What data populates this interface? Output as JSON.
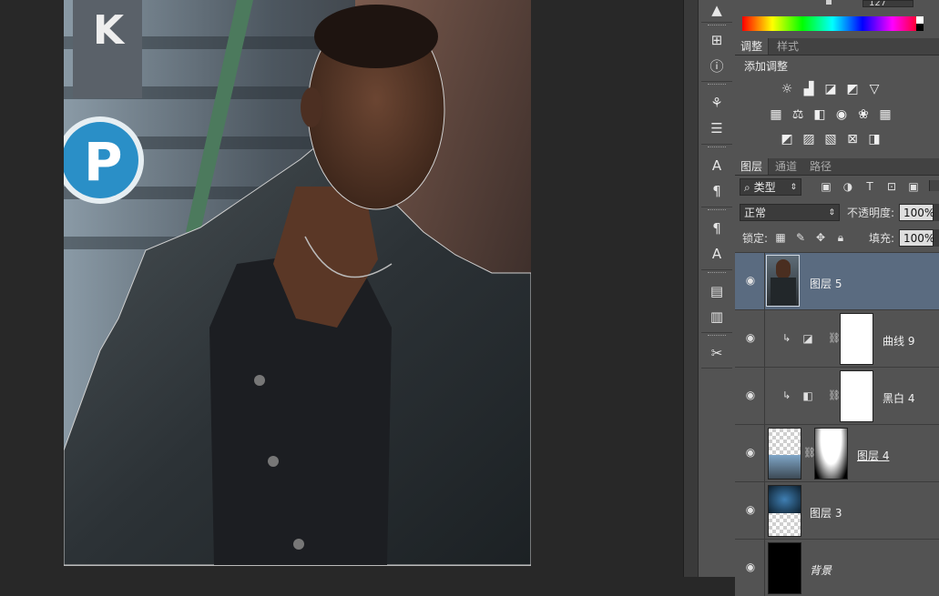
{
  "color_panel": {
    "value_field": "127"
  },
  "adjustments": {
    "tabs": [
      "调整",
      "样式"
    ],
    "title": "添加调整",
    "row1_icons": [
      "brightness-contrast-icon",
      "levels-icon",
      "curves-icon",
      "exposure-icon",
      "gradient-triangle-icon"
    ],
    "row2_icons": [
      "vibrance-icon",
      "color-balance-icon",
      "black-white-icon",
      "photo-filter-icon",
      "channel-mixer-icon",
      "color-lookup-icon"
    ],
    "row3_icons": [
      "invert-icon",
      "posterize-icon",
      "threshold-icon",
      "selective-color-icon",
      "gradient-map-icon"
    ]
  },
  "layers_panel": {
    "tabs": [
      "图层",
      "通道",
      "路径"
    ],
    "filter_kind": "类型",
    "blend_mode": "正常",
    "opacity_label": "不透明度:",
    "opacity_value": "100%",
    "lock_label": "锁定:",
    "fill_label": "填充:",
    "fill_value": "100%",
    "layers": [
      {
        "name": "图层 5",
        "selected": true
      },
      {
        "name": "曲线 9",
        "clipped": true
      },
      {
        "name": "黑白 4",
        "clipped": true
      },
      {
        "name": "图层 4",
        "has_mask": true
      },
      {
        "name": "图层 3"
      },
      {
        "name": "背景",
        "italic": true
      }
    ]
  },
  "photo": {
    "signage_letters": "K"
  }
}
